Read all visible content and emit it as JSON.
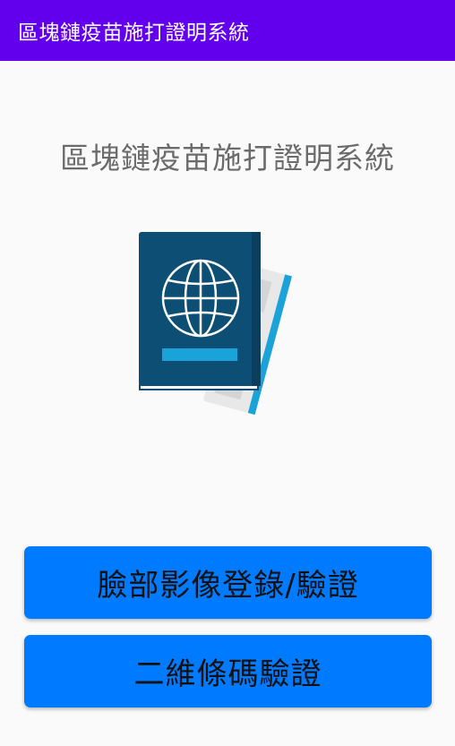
{
  "app_bar": {
    "title": "區塊鏈疫苗施打證明系統",
    "color": "#6200ee"
  },
  "main": {
    "title": "區塊鏈疫苗施打證明系統",
    "illustration_icon": "passport-icon",
    "buttons": [
      {
        "label": "臉部影像登錄/驗證",
        "color": "#007bff"
      },
      {
        "label": "二維條碼驗證",
        "color": "#007bff"
      }
    ]
  }
}
